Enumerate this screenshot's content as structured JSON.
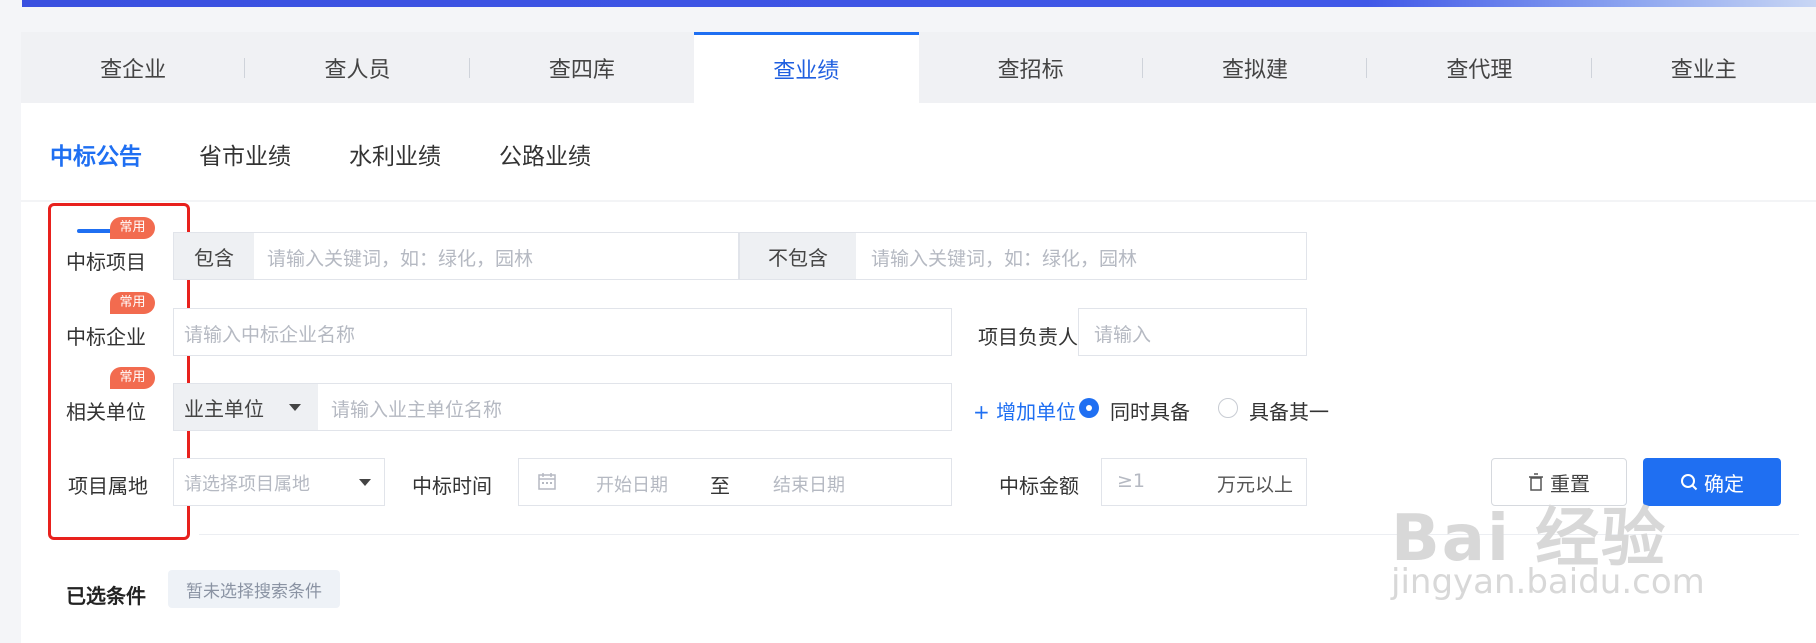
{
  "main_tabs": [
    "查企业",
    "查人员",
    "查四库",
    "查业绩",
    "查招标",
    "查拟建",
    "查代理",
    "查业主"
  ],
  "sub_tabs": [
    "中标公告",
    "省市业绩",
    "水利业绩",
    "公路业绩"
  ],
  "badge_label": "常用",
  "rows": {
    "project": {
      "label": "中标项目",
      "include_label": "包含",
      "include_placeholder": "请输入关键词，如：绿化，园林",
      "exclude_label": "不包含",
      "exclude_placeholder": "请输入关键词，如：绿化，园林"
    },
    "company": {
      "label": "中标企业",
      "placeholder": "请输入中标企业名称",
      "manager_label": "项目负责人",
      "manager_placeholder": "请输入"
    },
    "related": {
      "label": "相关单位",
      "unit_type": "业主单位",
      "placeholder": "请输入业主单位名称",
      "add_unit": "+ 增加单位",
      "radio_all": "同时具备",
      "radio_any": "具备其一",
      "selected": "radio_all"
    },
    "location": {
      "label": "项目属地",
      "placeholder": "请选择项目属地",
      "time_label": "中标时间",
      "start_placeholder": "开始日期",
      "to": "至",
      "end_placeholder": "结束日期",
      "amount_label": "中标金额",
      "amount_placeholder": "≥1",
      "amount_unit": "万元以上"
    }
  },
  "buttons": {
    "reset": "重置",
    "confirm": "确定"
  },
  "selected_conditions": {
    "label": "已选条件",
    "empty": "暂未选择搜索条件"
  },
  "watermark": {
    "main": "Bai 经验",
    "sub": "jingyan.baidu.com"
  },
  "colors": {
    "accent": "#1f6ff2",
    "badge": "#f26b4f",
    "highlight_box": "#e8211d"
  }
}
